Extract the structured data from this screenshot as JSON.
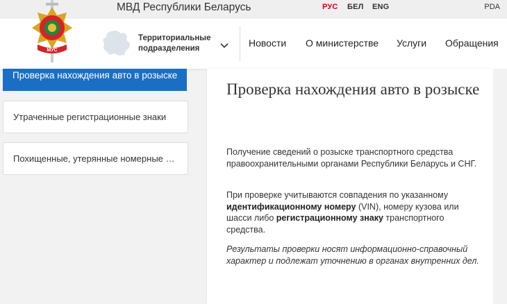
{
  "topbar": {
    "site_title": "МВД Республики Беларусь",
    "languages": [
      {
        "label": "РУС",
        "active": true
      },
      {
        "label": "БЕЛ",
        "active": false
      },
      {
        "label": "ENG",
        "active": false
      }
    ],
    "pda_label": "PDA"
  },
  "header": {
    "emblem_text": "МУС",
    "territorial_label_line1": "Территориальные",
    "territorial_label_line2": "подразделения",
    "nav": [
      {
        "label": "Новости"
      },
      {
        "label": "О министерстве"
      },
      {
        "label": "Услуги"
      },
      {
        "label": "Обращения"
      }
    ]
  },
  "sidebar": {
    "items": [
      {
        "label": "Проверка нахождения авто в розыске",
        "active": true
      },
      {
        "label": "Утраченные регистрационные знаки",
        "active": false
      },
      {
        "label": "Похищенные, утерянные номерные знаки",
        "active": false
      }
    ]
  },
  "main": {
    "title": "Проверка нахождения авто в розыске",
    "paragraph1": "Получение сведений о розыске транспортного средства правоохранительными органами Республики Беларусь и СНГ.",
    "paragraph2": {
      "t1": "При проверке учитываются совпадения по указанному ",
      "b1": "идентификационному номеру",
      "t2": " (VIN), номеру кузова или шасси либо ",
      "b2": "регистрационному знаку",
      "t3": " транспортного средства."
    },
    "paragraph3": "Результаты проверки носят информационно-справочный характер и подлежат уточнению в органах внутренних дел."
  },
  "colors": {
    "accent_blue": "#1a6fc4",
    "active_lang_red": "#d0021b",
    "emblem_red": "#d4232a",
    "emblem_gold": "#d9a521"
  }
}
